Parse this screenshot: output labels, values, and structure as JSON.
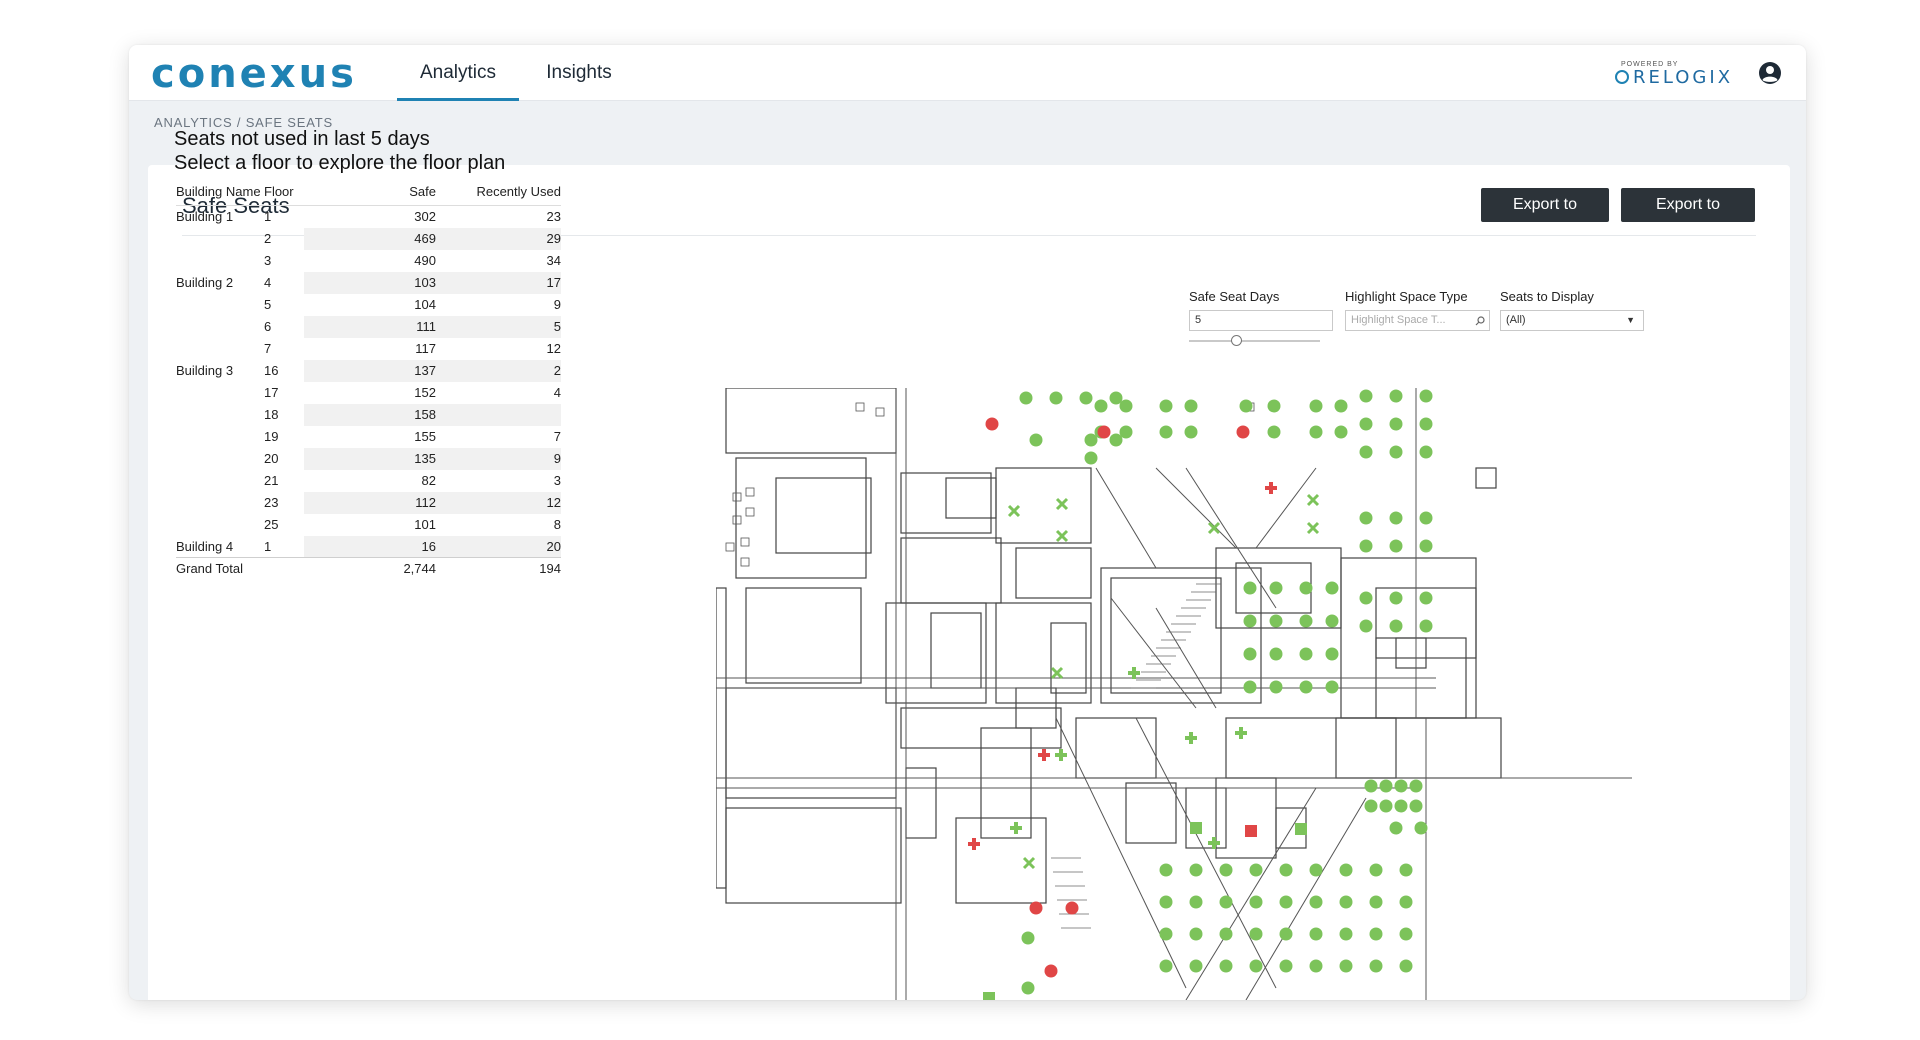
{
  "brand": {
    "name": "conexus",
    "powered_by": "POWERED BY",
    "partner": "RELOGIX"
  },
  "nav": {
    "tabs": [
      {
        "label": "Analytics",
        "active": true
      },
      {
        "label": "Insights",
        "active": false
      }
    ]
  },
  "breadcrumb": "ANALYTICS / SAFE SEATS",
  "page": {
    "title": "Safe Seats",
    "export_pdf": "Export to PDF",
    "export_png": "Export to PNG"
  },
  "viz": {
    "heading_line1": "Seats not used in last 5 days",
    "heading_line2": "Select a floor to explore the floor plan"
  },
  "table": {
    "columns": [
      "Building Name",
      "Floor",
      "Safe",
      "Recently Used"
    ],
    "rows": [
      {
        "building": "Building 1",
        "floor": "1",
        "safe": "302",
        "recent": "23"
      },
      {
        "building": "",
        "floor": "2",
        "safe": "469",
        "recent": "29"
      },
      {
        "building": "",
        "floor": "3",
        "safe": "490",
        "recent": "34"
      },
      {
        "building": "Building 2",
        "floor": "4",
        "safe": "103",
        "recent": "17"
      },
      {
        "building": "",
        "floor": "5",
        "safe": "104",
        "recent": "9"
      },
      {
        "building": "",
        "floor": "6",
        "safe": "111",
        "recent": "5"
      },
      {
        "building": "",
        "floor": "7",
        "safe": "117",
        "recent": "12"
      },
      {
        "building": "Building 3",
        "floor": "16",
        "safe": "137",
        "recent": "2"
      },
      {
        "building": "",
        "floor": "17",
        "safe": "152",
        "recent": "4"
      },
      {
        "building": "",
        "floor": "18",
        "safe": "158",
        "recent": ""
      },
      {
        "building": "",
        "floor": "19",
        "safe": "155",
        "recent": "7"
      },
      {
        "building": "",
        "floor": "20",
        "safe": "135",
        "recent": "9"
      },
      {
        "building": "",
        "floor": "21",
        "safe": "82",
        "recent": "3"
      },
      {
        "building": "",
        "floor": "23",
        "safe": "112",
        "recent": "12"
      },
      {
        "building": "",
        "floor": "25",
        "safe": "101",
        "recent": "8"
      },
      {
        "building": "Building 4",
        "floor": "1",
        "safe": "16",
        "recent": "20"
      }
    ],
    "grand_total": {
      "label": "Grand Total",
      "safe": "2,744",
      "recent": "194"
    }
  },
  "filters": {
    "safe_seat_days": {
      "label": "Safe Seat Days",
      "value": "5"
    },
    "highlight_space_type": {
      "label": "Highlight Space Type",
      "placeholder": "Highlight Space T..."
    },
    "seats_to_display": {
      "label": "Seats to Display",
      "value": "(All)"
    }
  },
  "colors": {
    "brand": "#1f82b3",
    "safe_seat": "#7cc35a",
    "recently_used": "#e04646",
    "button": "#2c3339"
  },
  "legend_semantics": {
    "green": "safe seat",
    "red": "recently used seat"
  }
}
